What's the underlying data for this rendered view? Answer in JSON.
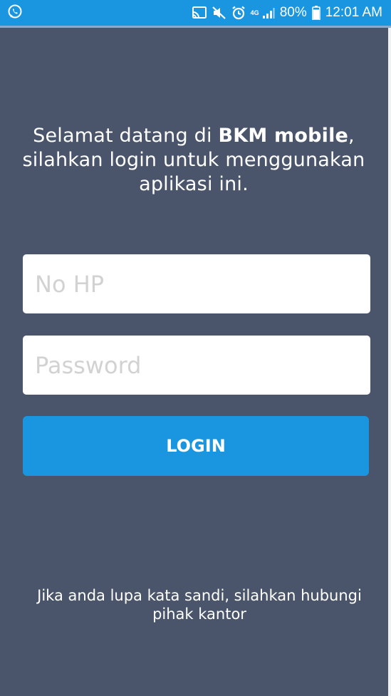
{
  "status_bar": {
    "battery": "80%",
    "time": "12:01 AM",
    "network": "4G",
    "icons": [
      "whatsapp-icon",
      "cast-icon",
      "mute-icon",
      "alarm-icon",
      "signal-icon",
      "battery-icon"
    ]
  },
  "welcome": {
    "prefix": "Selamat datang di ",
    "app_name": "BKM mobile",
    "suffix": ", silahkan login untuk menggunakan aplikasi ini."
  },
  "form": {
    "phone_placeholder": "No HP",
    "password_placeholder": "Password",
    "login_label": "LOGIN"
  },
  "footer": {
    "forgot_text": "Jika anda lupa kata sandi, silahkan hubungi pihak kantor"
  },
  "colors": {
    "background": "#4a556b",
    "accent": "#1a96e0"
  }
}
